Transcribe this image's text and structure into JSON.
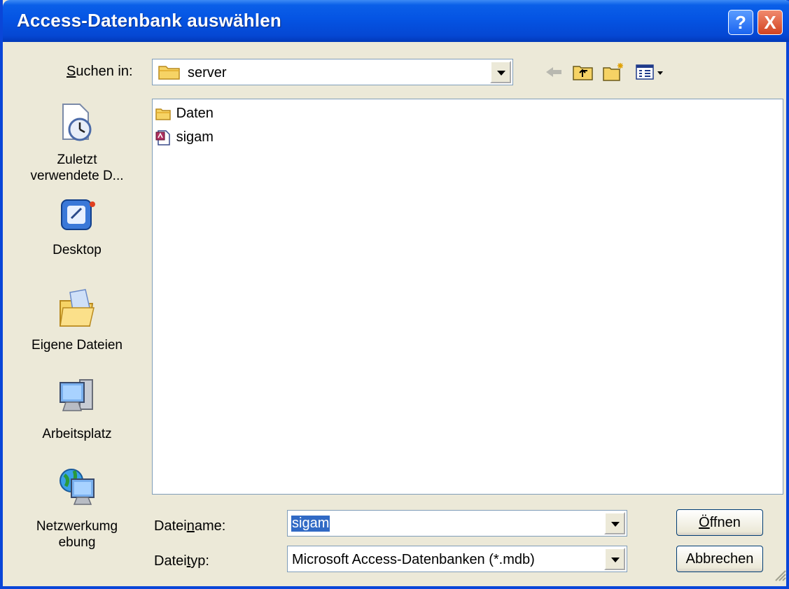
{
  "dialog": {
    "title": "Access-Datenbank auswählen",
    "help_glyph": "?",
    "close_glyph": "X"
  },
  "lookin": {
    "label_prefix": "",
    "label_underline": "S",
    "label_rest": "uchen in:",
    "value": "server",
    "value_icon": "folder-icon"
  },
  "toolbar": {
    "back_icon": "back-arrow-icon",
    "up_icon": "folder-up-icon",
    "new_folder_icon": "new-folder-icon",
    "view_menu_icon": "view-menu-icon"
  },
  "places": [
    {
      "name": "recent",
      "label": "Zuletzt verwendete D...",
      "icon": "recent-documents-icon"
    },
    {
      "name": "desktop",
      "label": "Desktop",
      "icon": "desktop-icon"
    },
    {
      "name": "my-documents",
      "label": "Eigene Dateien",
      "icon": "my-documents-icon"
    },
    {
      "name": "my-computer",
      "label": "Arbeitsplatz",
      "icon": "my-computer-icon"
    },
    {
      "name": "network",
      "label": "Netzwerkumgebung",
      "icon": "network-icon"
    }
  ],
  "files": [
    {
      "name": "Daten",
      "icon": "folder-icon"
    },
    {
      "name": "sigam",
      "icon": "access-database-icon"
    }
  ],
  "filename": {
    "label_prefix": "Datei",
    "label_underline": "n",
    "label_rest": "ame:",
    "value": "sigam"
  },
  "filetype": {
    "label_prefix": "Datei",
    "label_underline": "t",
    "label_rest": "yp:",
    "value": "Microsoft Access-Datenbanken (*.mdb)"
  },
  "buttons": {
    "open_underline": "Ö",
    "open_rest": "ffnen",
    "cancel": "Abbrechen"
  },
  "colors": {
    "titlebar": "#0554e3",
    "face": "#ece9d8",
    "selection": "#316ac5"
  }
}
